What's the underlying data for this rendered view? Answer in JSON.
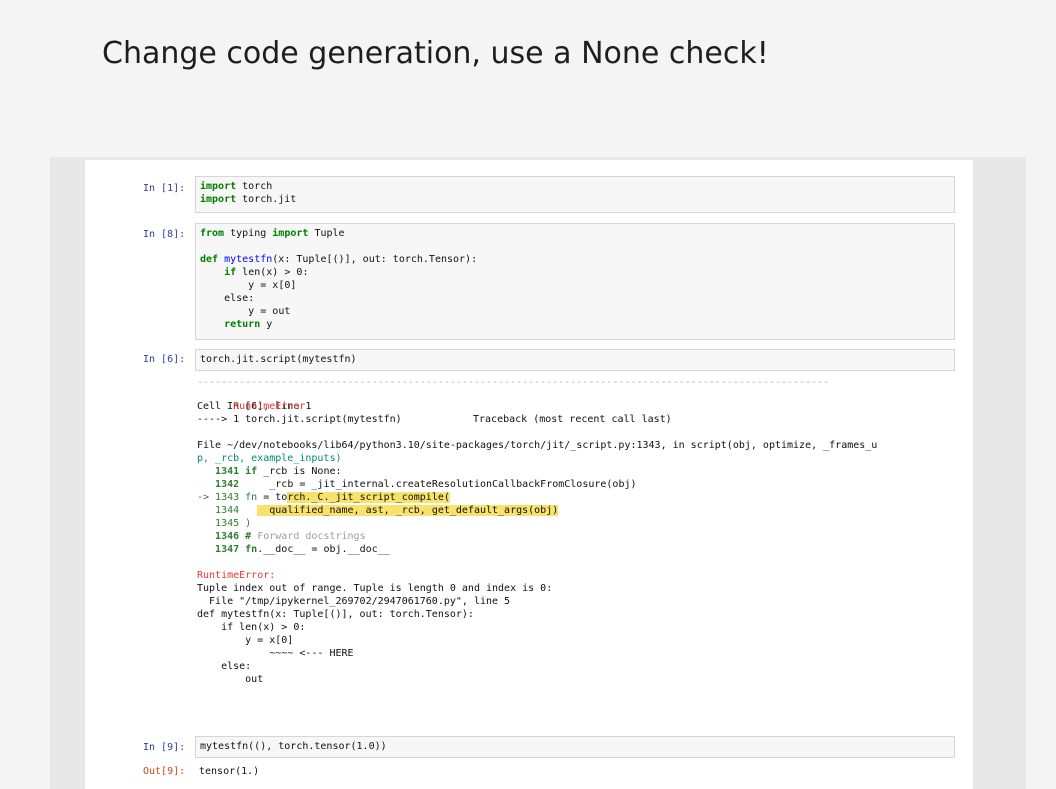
{
  "slide": {
    "title": "Change code generation, use a None check!"
  },
  "cells": {
    "c1": {
      "prompt": "In [1]:",
      "lines": [
        "import torch",
        "import torch.jit"
      ]
    },
    "c2": {
      "prompt": "In [8]:",
      "lines": [
        "from typing import Tuple",
        "",
        "def mytestfn(x: Tuple[()], out: torch.Tensor):",
        "    if len(x) > 0:",
        "        y = x[0]",
        "    else:",
        "        y = out",
        "    return y"
      ]
    },
    "c3": {
      "prompt": "In [6]:",
      "lines": [
        "torch.jit.script(mytestfn)"
      ]
    },
    "c4": {
      "prompt": "In [9]:",
      "lines": [
        "mytestfn((), torch.tensor(1.0))"
      ],
      "out_prompt": "Out[9]:",
      "out_value": "tensor(1.)"
    }
  },
  "traceback": {
    "dashes": "---------------------------------------------------------------------------------------------------------",
    "error_name": "RuntimeError",
    "header_right": "Traceback (most recent call last)",
    "cell_line": "Cell In [6], line 1",
    "arrow_line": "----> 1 torch.jit.script(mytestfn)",
    "file_line_1": "File ~/dev/notebooks/lib64/python3.10/site-packages/torch/jit/_script.py:1343, in script(obj, optimize, _frames_u",
    "file_line_2": "p, _rcb, example_inputs)",
    "src": [
      "   1341 if _rcb is None:",
      "   1342     _rcb = _jit_internal.createResolutionCallbackFromClosure(obj)",
      "-> 1343 fn = torch._C._jit_script_compile(",
      "   1344     qualified_name, ast, _rcb, get_default_args(obj)",
      "   1345 )",
      "   1346 # Forward docstrings",
      "   1347 fn.__doc__ = obj.__doc__"
    ],
    "err2_name": "RuntimeError:",
    "msg": [
      "Tuple index out of range. Tuple is length 0 and index is 0:",
      "  File \"/tmp/ipykernel_269702/2947061760.py\", line 5",
      "def mytestfn(x: Tuple[()], out: torch.Tensor):",
      "    if len(x) > 0:",
      "        y = x[0]",
      "            ~~~~ <--- HERE",
      "    else:",
      "        out"
    ]
  }
}
